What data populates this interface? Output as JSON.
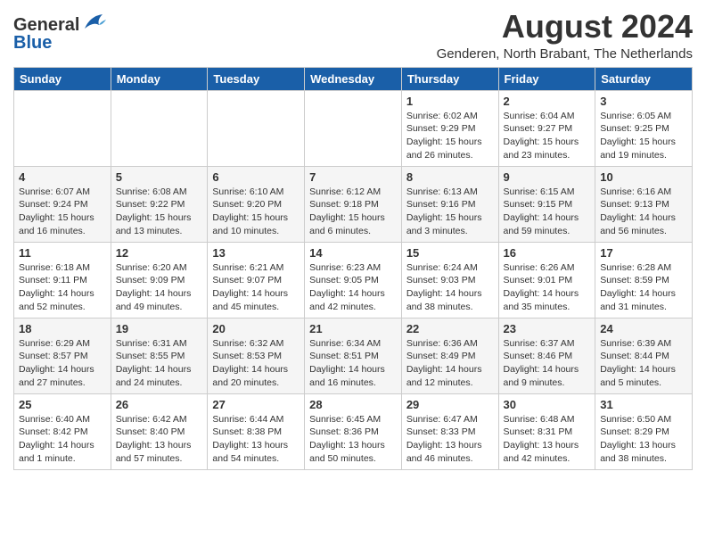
{
  "logo": {
    "general": "General",
    "blue": "Blue"
  },
  "title": "August 2024",
  "location": "Genderen, North Brabant, The Netherlands",
  "weekdays": [
    "Sunday",
    "Monday",
    "Tuesday",
    "Wednesday",
    "Thursday",
    "Friday",
    "Saturday"
  ],
  "weeks": [
    [
      {
        "day": "",
        "info": ""
      },
      {
        "day": "",
        "info": ""
      },
      {
        "day": "",
        "info": ""
      },
      {
        "day": "",
        "info": ""
      },
      {
        "day": "1",
        "info": "Sunrise: 6:02 AM\nSunset: 9:29 PM\nDaylight: 15 hours\nand 26 minutes."
      },
      {
        "day": "2",
        "info": "Sunrise: 6:04 AM\nSunset: 9:27 PM\nDaylight: 15 hours\nand 23 minutes."
      },
      {
        "day": "3",
        "info": "Sunrise: 6:05 AM\nSunset: 9:25 PM\nDaylight: 15 hours\nand 19 minutes."
      }
    ],
    [
      {
        "day": "4",
        "info": "Sunrise: 6:07 AM\nSunset: 9:24 PM\nDaylight: 15 hours\nand 16 minutes."
      },
      {
        "day": "5",
        "info": "Sunrise: 6:08 AM\nSunset: 9:22 PM\nDaylight: 15 hours\nand 13 minutes."
      },
      {
        "day": "6",
        "info": "Sunrise: 6:10 AM\nSunset: 9:20 PM\nDaylight: 15 hours\nand 10 minutes."
      },
      {
        "day": "7",
        "info": "Sunrise: 6:12 AM\nSunset: 9:18 PM\nDaylight: 15 hours\nand 6 minutes."
      },
      {
        "day": "8",
        "info": "Sunrise: 6:13 AM\nSunset: 9:16 PM\nDaylight: 15 hours\nand 3 minutes."
      },
      {
        "day": "9",
        "info": "Sunrise: 6:15 AM\nSunset: 9:15 PM\nDaylight: 14 hours\nand 59 minutes."
      },
      {
        "day": "10",
        "info": "Sunrise: 6:16 AM\nSunset: 9:13 PM\nDaylight: 14 hours\nand 56 minutes."
      }
    ],
    [
      {
        "day": "11",
        "info": "Sunrise: 6:18 AM\nSunset: 9:11 PM\nDaylight: 14 hours\nand 52 minutes."
      },
      {
        "day": "12",
        "info": "Sunrise: 6:20 AM\nSunset: 9:09 PM\nDaylight: 14 hours\nand 49 minutes."
      },
      {
        "day": "13",
        "info": "Sunrise: 6:21 AM\nSunset: 9:07 PM\nDaylight: 14 hours\nand 45 minutes."
      },
      {
        "day": "14",
        "info": "Sunrise: 6:23 AM\nSunset: 9:05 PM\nDaylight: 14 hours\nand 42 minutes."
      },
      {
        "day": "15",
        "info": "Sunrise: 6:24 AM\nSunset: 9:03 PM\nDaylight: 14 hours\nand 38 minutes."
      },
      {
        "day": "16",
        "info": "Sunrise: 6:26 AM\nSunset: 9:01 PM\nDaylight: 14 hours\nand 35 minutes."
      },
      {
        "day": "17",
        "info": "Sunrise: 6:28 AM\nSunset: 8:59 PM\nDaylight: 14 hours\nand 31 minutes."
      }
    ],
    [
      {
        "day": "18",
        "info": "Sunrise: 6:29 AM\nSunset: 8:57 PM\nDaylight: 14 hours\nand 27 minutes."
      },
      {
        "day": "19",
        "info": "Sunrise: 6:31 AM\nSunset: 8:55 PM\nDaylight: 14 hours\nand 24 minutes."
      },
      {
        "day": "20",
        "info": "Sunrise: 6:32 AM\nSunset: 8:53 PM\nDaylight: 14 hours\nand 20 minutes."
      },
      {
        "day": "21",
        "info": "Sunrise: 6:34 AM\nSunset: 8:51 PM\nDaylight: 14 hours\nand 16 minutes."
      },
      {
        "day": "22",
        "info": "Sunrise: 6:36 AM\nSunset: 8:49 PM\nDaylight: 14 hours\nand 12 minutes."
      },
      {
        "day": "23",
        "info": "Sunrise: 6:37 AM\nSunset: 8:46 PM\nDaylight: 14 hours\nand 9 minutes."
      },
      {
        "day": "24",
        "info": "Sunrise: 6:39 AM\nSunset: 8:44 PM\nDaylight: 14 hours\nand 5 minutes."
      }
    ],
    [
      {
        "day": "25",
        "info": "Sunrise: 6:40 AM\nSunset: 8:42 PM\nDaylight: 14 hours\nand 1 minute."
      },
      {
        "day": "26",
        "info": "Sunrise: 6:42 AM\nSunset: 8:40 PM\nDaylight: 13 hours\nand 57 minutes."
      },
      {
        "day": "27",
        "info": "Sunrise: 6:44 AM\nSunset: 8:38 PM\nDaylight: 13 hours\nand 54 minutes."
      },
      {
        "day": "28",
        "info": "Sunrise: 6:45 AM\nSunset: 8:36 PM\nDaylight: 13 hours\nand 50 minutes."
      },
      {
        "day": "29",
        "info": "Sunrise: 6:47 AM\nSunset: 8:33 PM\nDaylight: 13 hours\nand 46 minutes."
      },
      {
        "day": "30",
        "info": "Sunrise: 6:48 AM\nSunset: 8:31 PM\nDaylight: 13 hours\nand 42 minutes."
      },
      {
        "day": "31",
        "info": "Sunrise: 6:50 AM\nSunset: 8:29 PM\nDaylight: 13 hours\nand 38 minutes."
      }
    ]
  ]
}
